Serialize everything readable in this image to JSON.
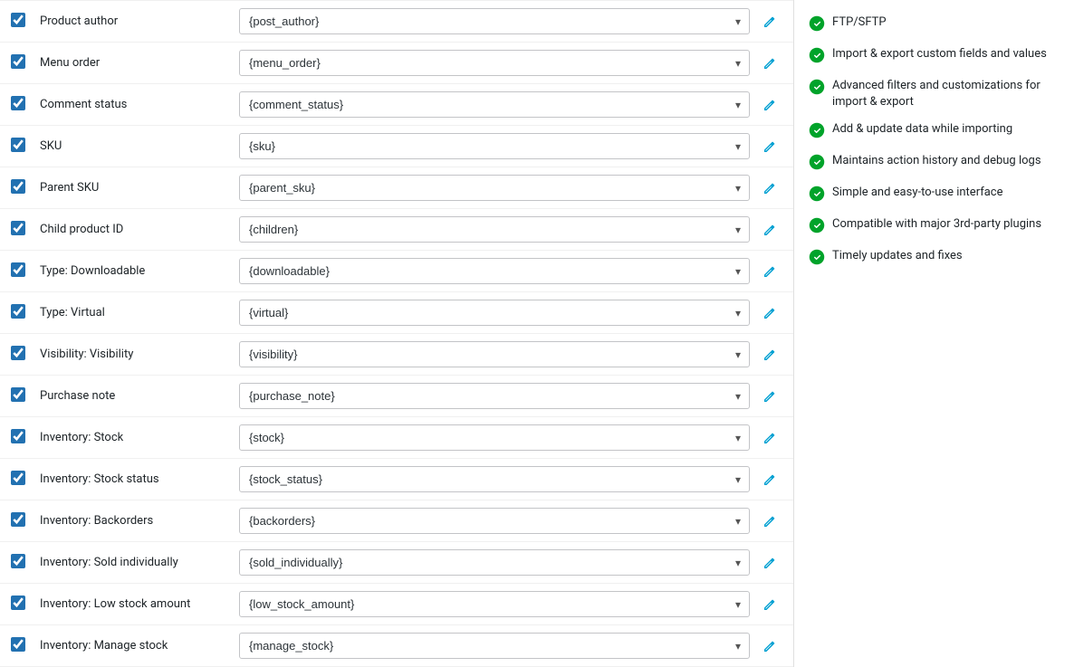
{
  "fields": [
    {
      "id": "product-author",
      "label": "Product author",
      "value": "{post_author}",
      "checked": true
    },
    {
      "id": "menu-order",
      "label": "Menu order",
      "value": "{menu_order}",
      "checked": true
    },
    {
      "id": "comment-status",
      "label": "Comment status",
      "value": "{comment_status}",
      "checked": true
    },
    {
      "id": "sku",
      "label": "SKU",
      "value": "{sku}",
      "checked": true
    },
    {
      "id": "parent-sku",
      "label": "Parent SKU",
      "value": "{parent_sku}",
      "checked": true
    },
    {
      "id": "child-product-id",
      "label": "Child product ID",
      "value": "{children}",
      "checked": true
    },
    {
      "id": "type-downloadable",
      "label": "Type: Downloadable",
      "value": "{downloadable}",
      "checked": true
    },
    {
      "id": "type-virtual",
      "label": "Type: Virtual",
      "value": "{virtual}",
      "checked": true
    },
    {
      "id": "visibility-visibility",
      "label": "Visibility: Visibility",
      "value": "{visibility}",
      "checked": true
    },
    {
      "id": "purchase-note",
      "label": "Purchase note",
      "value": "{purchase_note}",
      "checked": true
    },
    {
      "id": "inventory-stock",
      "label": "Inventory: Stock",
      "value": "{stock}",
      "checked": true
    },
    {
      "id": "inventory-stock-status",
      "label": "Inventory: Stock status",
      "value": "{stock_status}",
      "checked": true
    },
    {
      "id": "inventory-backorders",
      "label": "Inventory: Backorders",
      "value": "{backorders}",
      "checked": true
    },
    {
      "id": "inventory-sold-individually",
      "label": "Inventory: Sold individually",
      "value": "{sold_individually}",
      "checked": true
    },
    {
      "id": "inventory-low-stock",
      "label": "Inventory: Low stock amount",
      "value": "{low_stock_amount}",
      "checked": true
    },
    {
      "id": "inventory-manage-stock",
      "label": "Inventory: Manage stock",
      "value": "{manage_stock}",
      "checked": true
    }
  ],
  "sidebar": {
    "features": [
      {
        "id": "ftp-sftp",
        "text": "FTP/SFTP",
        "bold": false
      },
      {
        "id": "import-export-custom",
        "text": "Import & export custom fields and values",
        "bold": false
      },
      {
        "id": "advanced-filters",
        "text": "Advanced filters and customizations for import & export",
        "bold": false
      },
      {
        "id": "add-update-data",
        "text": "Add & update data while importing",
        "bold": false
      },
      {
        "id": "action-history",
        "text": "Maintains action history and debug logs",
        "bold": false
      },
      {
        "id": "simple-interface",
        "text": "Simple and easy-to-use interface",
        "bold": false
      },
      {
        "id": "compatible-plugins",
        "text": "Compatible with major 3rd-party plugins",
        "bold": false
      },
      {
        "id": "timely-updates",
        "text": "Timely updates and fixes",
        "bold": false
      }
    ]
  },
  "colors": {
    "check_green": "#00a32a",
    "link_blue": "#00a0d2"
  }
}
